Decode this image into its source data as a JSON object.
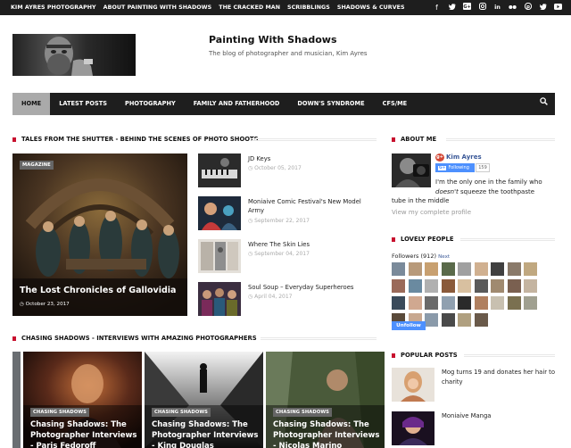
{
  "topbar": {
    "links": [
      "KIM AYRES PHOTOGRAPHY",
      "ABOUT PAINTING WITH SHADOWS",
      "THE CRACKED MAN",
      "SCRIBBLINGS",
      "SHADOWS & CURVES"
    ],
    "social_icons": [
      "facebook-icon",
      "twitter-icon",
      "google-plus-icon",
      "instagram-icon",
      "linkedin-icon",
      "flickr-icon",
      "pinterest-icon",
      "twitter-bird-icon",
      "youtube-icon"
    ],
    "social_glyphs": [
      "f",
      "✦",
      "G+",
      "◎",
      "in",
      "●",
      "℗",
      "❂",
      "▶"
    ]
  },
  "header": {
    "title": "Painting With Shadows",
    "description": "The blog of photographer and musician, Kim Ayres"
  },
  "nav": {
    "items": [
      "HOME",
      "LATEST POSTS",
      "PHOTOGRAPHY",
      "FAMILY AND FATHERHOOD",
      "DOWN'S SYNDROME",
      "CFS/ME"
    ],
    "search_icon": "⚲"
  },
  "tales": {
    "heading": "TALES FROM THE SHUTTER - BEHIND THE SCENES OF PHOTO SHOOTS",
    "feature": {
      "badge": "MAGAZINE",
      "title": "The Lost Chronicles of Gallovidia",
      "date": "October 23, 2017"
    },
    "posts": [
      {
        "title": "JD Keys",
        "date": "October 05, 2017"
      },
      {
        "title": "Moniaive Comic Festival's New Model Army",
        "date": "September 22, 2017"
      },
      {
        "title": "Where The Skin Lies",
        "date": "September 04, 2017"
      },
      {
        "title": "Soul Soup – Everyday Superheroes",
        "date": "April 04, 2017"
      }
    ]
  },
  "chasing": {
    "heading": "CHASING SHADOWS - INTERVIEWS WITH AMAZING PHOTOGRAPHERS",
    "cards": [
      {
        "badge": "CHASING SHADOWS",
        "title": "Chasing Shadows: The Photographer Interviews - Paris Fedoroff"
      },
      {
        "badge": "CHASING SHADOWS",
        "title": "Chasing Shadows: The Photographer Interviews - King Douglas"
      },
      {
        "badge": "CHASING SHADOWS",
        "title": "Chasing Shadows: The Photographer Interviews - Nicolas Marino"
      }
    ]
  },
  "about": {
    "heading": "ABOUT ME",
    "name": "Kim Ayres",
    "follow_label": "Following",
    "follow_count": "159",
    "text_line1_a": "I'm the only one in the family who",
    "text_line2_em": "doesn't",
    "text_line2_b": "squeeze the toothpaste",
    "text_line3": "tube in the middle",
    "profile_link": "View my complete profile"
  },
  "lovely": {
    "heading": "LOVELY PEOPLE",
    "followers_label": "Followers (912)",
    "next_label": "Next",
    "unfollow_label": "Unfollow"
  },
  "popular": {
    "heading": "POPULAR POSTS",
    "posts": [
      {
        "title": "Mog turns 19 and donates her hair to charity"
      },
      {
        "title": "Moniaive Manga"
      }
    ]
  },
  "colors": {
    "accent": "#c8102e",
    "dark_bar": "#1e1e1e",
    "link_blue": "#3b5998",
    "google_blue": "#4d90fe"
  }
}
